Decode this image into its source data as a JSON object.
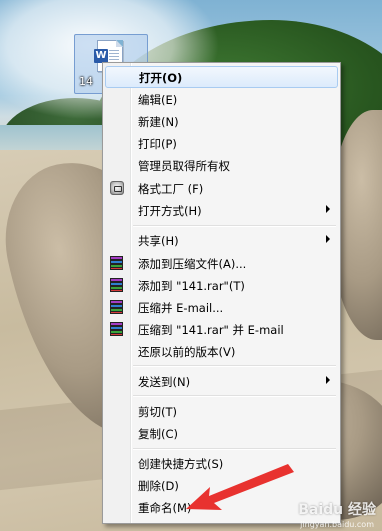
{
  "desktop": {
    "file_label": "14",
    "file_icon": "word-document-icon"
  },
  "context_menu": {
    "items": [
      {
        "label": "打开(O)",
        "bold": true,
        "highlight": true
      },
      {
        "label": "编辑(E)"
      },
      {
        "label": "新建(N)"
      },
      {
        "label": "打印(P)"
      },
      {
        "label": "管理员取得所有权"
      },
      {
        "label": "格式工厂 (F)",
        "icon": "format-factory-icon"
      },
      {
        "label": "打开方式(H)",
        "submenu": true
      },
      {
        "label": "共享(H)",
        "submenu": true
      },
      {
        "label": "添加到压缩文件(A)...",
        "icon": "winrar-icon"
      },
      {
        "label": "添加到 \"141.rar\"(T)",
        "icon": "winrar-icon"
      },
      {
        "label": "压缩并 E-mail...",
        "icon": "winrar-icon"
      },
      {
        "label": "压缩到 \"141.rar\" 并 E-mail",
        "icon": "winrar-icon"
      },
      {
        "label": "还原以前的版本(V)"
      },
      {
        "label": "发送到(N)",
        "submenu": true
      },
      {
        "label": "剪切(T)"
      },
      {
        "label": "复制(C)"
      },
      {
        "label": "创建快捷方式(S)"
      },
      {
        "label": "删除(D)"
      },
      {
        "label": "重命名(M)"
      }
    ]
  },
  "annotation": {
    "color": "#e8322f",
    "points_to": "重命名(M)"
  },
  "watermark": {
    "brand": "Baidu 经验",
    "sub": "jingyan.baidu.com"
  }
}
